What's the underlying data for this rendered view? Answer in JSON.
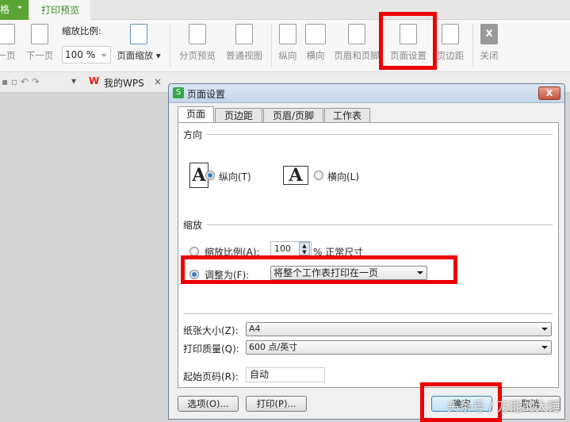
{
  "app": {
    "left_tab": "格",
    "active_tab": "打印预览"
  },
  "toolbar": {
    "prev_page": "一页",
    "next_page": "下一页",
    "zoom_label": "缩放比例:",
    "zoom_value": "100 %",
    "page_zoom": "页面缩放",
    "page_break_preview": "分页预览",
    "normal_view": "普通视图",
    "portrait": "纵向",
    "landscape": "横向",
    "header_footer": "页眉和页脚",
    "page_setup": "页面设置",
    "margins": "页边距",
    "close": "关闭"
  },
  "doc_tabs": {
    "my_wps": "我的WPS",
    "close": "×"
  },
  "dialog": {
    "title": "页面设置",
    "close": "X",
    "tabs": [
      "页面",
      "页边距",
      "页眉/页脚",
      "工作表"
    ],
    "orientation": {
      "heading": "方向",
      "portrait": "纵向(T)",
      "landscape": "横向(L)",
      "icon_letter": "A"
    },
    "scaling": {
      "heading": "缩放",
      "scale_label": "缩放比例(A):",
      "scale_value": "100",
      "scale_suffix": "% 正常尺寸",
      "fit_label": "调整为(F):",
      "fit_value": "将整个工作表打印在一页"
    },
    "paper_size_label": "纸张大小(Z):",
    "paper_size": "A4",
    "print_quality_label": "打印质量(Q):",
    "print_quality": "600 点/英寸",
    "first_page_label": "起始页码(R):",
    "first_page": "自动",
    "buttons": {
      "options": "选项(O)...",
      "print": "打印(P)...",
      "ok": "确定",
      "cancel": "取消"
    }
  },
  "watermark": "头条号 / 万能的大锤"
}
